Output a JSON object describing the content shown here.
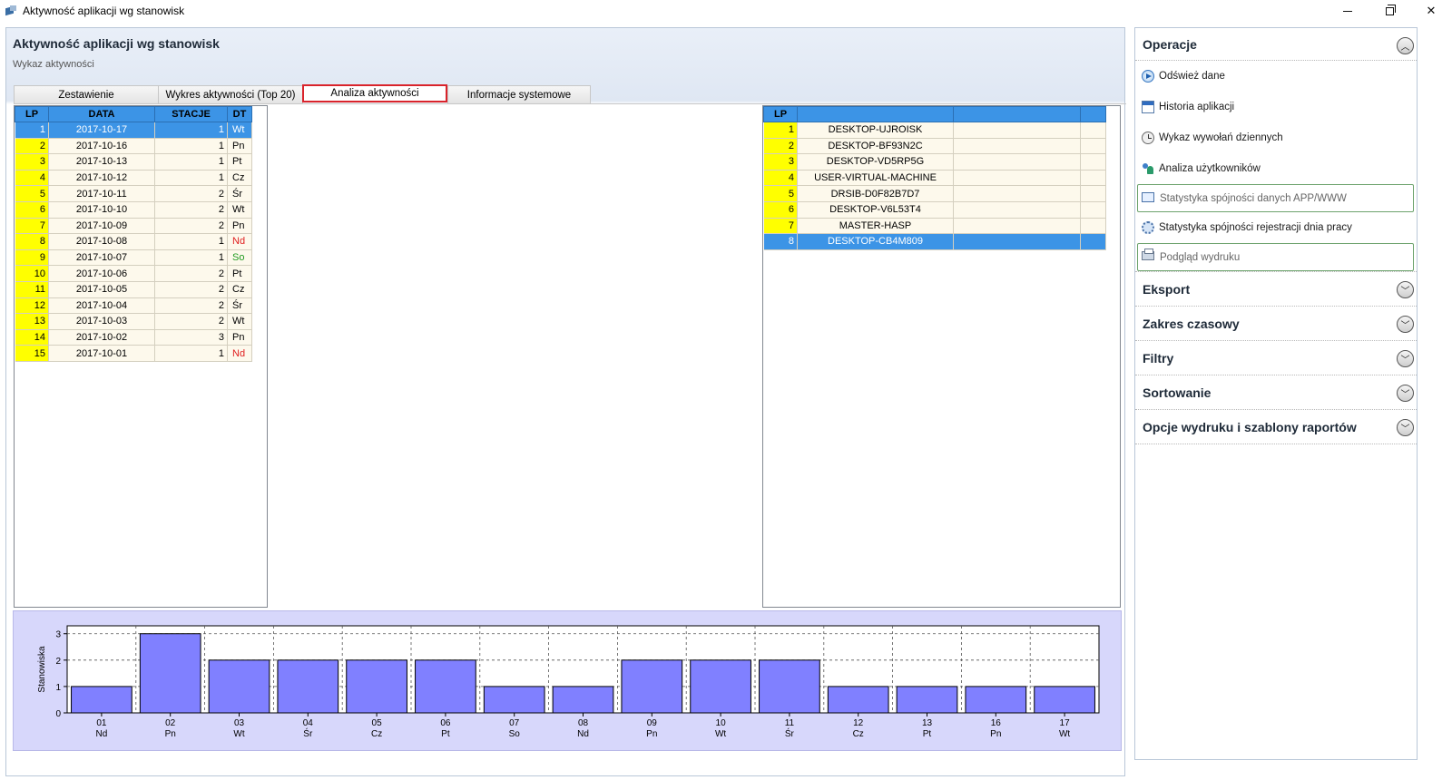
{
  "window": {
    "title": "Aktywność aplikacji wg stanowisk",
    "min": "—",
    "max": "☐",
    "close": "✕"
  },
  "header": {
    "title": "Aktywność aplikacji wg stanowisk",
    "subtitle": "Wykaz aktywności"
  },
  "tabs": [
    {
      "label": "Zestawienie"
    },
    {
      "label": "Wykres aktywności (Top 20)"
    },
    {
      "label": "Analiza aktywności",
      "active": true
    },
    {
      "label": "Informacje systemowe"
    }
  ],
  "left_grid": {
    "columns": [
      "LP",
      "DATA",
      "STACJE",
      "DT"
    ],
    "rows": [
      {
        "lp": "1",
        "data": "2017-10-17",
        "stacje": "1",
        "dt": "Wt",
        "selected": true
      },
      {
        "lp": "2",
        "data": "2017-10-16",
        "stacje": "1",
        "dt": "Pn"
      },
      {
        "lp": "3",
        "data": "2017-10-13",
        "stacje": "1",
        "dt": "Pt"
      },
      {
        "lp": "4",
        "data": "2017-10-12",
        "stacje": "1",
        "dt": "Cz"
      },
      {
        "lp": "5",
        "data": "2017-10-11",
        "stacje": "2",
        "dt": "Śr"
      },
      {
        "lp": "6",
        "data": "2017-10-10",
        "stacje": "2",
        "dt": "Wt"
      },
      {
        "lp": "7",
        "data": "2017-10-09",
        "stacje": "2",
        "dt": "Pn"
      },
      {
        "lp": "8",
        "data": "2017-10-08",
        "stacje": "1",
        "dt": "Nd",
        "color": "red"
      },
      {
        "lp": "9",
        "data": "2017-10-07",
        "stacje": "1",
        "dt": "So",
        "color": "green"
      },
      {
        "lp": "10",
        "data": "2017-10-06",
        "stacje": "2",
        "dt": "Pt"
      },
      {
        "lp": "11",
        "data": "2017-10-05",
        "stacje": "2",
        "dt": "Cz"
      },
      {
        "lp": "12",
        "data": "2017-10-04",
        "stacje": "2",
        "dt": "Śr"
      },
      {
        "lp": "13",
        "data": "2017-10-03",
        "stacje": "2",
        "dt": "Wt"
      },
      {
        "lp": "14",
        "data": "2017-10-02",
        "stacje": "3",
        "dt": "Pn"
      },
      {
        "lp": "15",
        "data": "2017-10-01",
        "stacje": "1",
        "dt": "Nd",
        "color": "red"
      }
    ]
  },
  "right_grid": {
    "columns": [
      "LP",
      "",
      "",
      ""
    ],
    "rows": [
      {
        "lp": "1",
        "name": "DESKTOP-UJROISK"
      },
      {
        "lp": "2",
        "name": "DESKTOP-BF93N2C"
      },
      {
        "lp": "3",
        "name": "DESKTOP-VD5RP5G"
      },
      {
        "lp": "4",
        "name": "USER-VIRTUAL-MACHINE"
      },
      {
        "lp": "5",
        "name": "DRSIB-D0F82B7D7"
      },
      {
        "lp": "6",
        "name": "DESKTOP-V6L53T4"
      },
      {
        "lp": "7",
        "name": "MASTER-HASP"
      },
      {
        "lp": "8",
        "name": "DESKTOP-CB4M809",
        "selected": true
      }
    ]
  },
  "chart_data": {
    "type": "bar",
    "ylabel": "Stanowiska",
    "xlabel": "",
    "ylim": [
      0,
      3.3
    ],
    "yticks": [
      "0",
      "1",
      "2",
      "3"
    ],
    "categories": [
      "01",
      "02",
      "03",
      "04",
      "05",
      "06",
      "07",
      "08",
      "09",
      "10",
      "11",
      "12",
      "13",
      "16",
      "17"
    ],
    "sublabels": [
      "Nd",
      "Pn",
      "Wt",
      "Śr",
      "Cz",
      "Pt",
      "So",
      "Nd",
      "Pn",
      "Wt",
      "Śr",
      "Cz",
      "Pt",
      "Pn",
      "Wt"
    ],
    "values": [
      1,
      3,
      2,
      2,
      2,
      2,
      1,
      1,
      2,
      2,
      2,
      1,
      1,
      1,
      1
    ],
    "grid": true,
    "bar_color": "#8080ff",
    "background": "#d7d7fb"
  },
  "sidebar": {
    "operacje": {
      "title": "Operacje",
      "toggle": "︿",
      "items": [
        {
          "label": "Odśwież dane",
          "icon": "refresh-play-icon"
        },
        {
          "label": "Historia aplikacji",
          "icon": "document-icon"
        },
        {
          "label": "Wykaz wywołań dziennych",
          "icon": "clock-icon"
        },
        {
          "label": "Analiza użytkowników",
          "icon": "users-icon"
        },
        {
          "label": "Statystyka spójności danych APP/WWW",
          "icon": "monitor-icon",
          "disabled": true
        },
        {
          "label": "Statystyka spójności rejestracji dnia pracy",
          "icon": "gear-icon"
        },
        {
          "label": "Podgląd wydruku",
          "icon": "printer-icon",
          "disabled": true
        }
      ]
    },
    "sections": [
      {
        "title": "Eksport",
        "toggle": "﹀"
      },
      {
        "title": "Zakres czasowy",
        "toggle": "﹀"
      },
      {
        "title": "Filtry",
        "toggle": "﹀"
      },
      {
        "title": "Sortowanie",
        "toggle": "﹀"
      },
      {
        "title": "Opcje wydruku i szablony raportów",
        "toggle": "﹀"
      }
    ]
  }
}
